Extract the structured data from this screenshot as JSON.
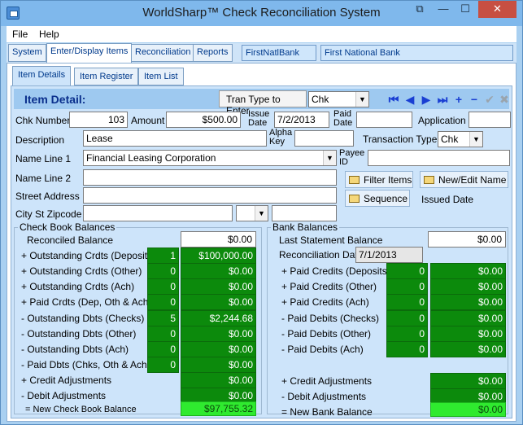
{
  "window": {
    "title": "WorldSharp™ Check Reconciliation System"
  },
  "menu": {
    "file": "File",
    "help": "Help"
  },
  "main_tabs": {
    "system": "System",
    "enter_display": "Enter/Display Items",
    "reconciliation": "Reconciliation",
    "reports": "Reports",
    "bank_code": "FirstNatlBank",
    "bank_name": "First National Bank"
  },
  "sub_tabs": {
    "item_details": "Item Details",
    "item_register": "Item Register",
    "item_list": "Item List"
  },
  "item_detail": {
    "title": "Item Detail:",
    "tran_type_label": "Tran Type to Enter",
    "tran_type_value": "Chk"
  },
  "form": {
    "chk_number_label": "Chk Number",
    "chk_number": "103",
    "amount_label": "Amount",
    "amount": "$500.00",
    "issue_date_label": "Issue Date",
    "issue_date": "7/2/2013",
    "paid_date_label": "Paid Date",
    "paid_date": "",
    "application_label": "Application",
    "application": "",
    "description_label": "Description",
    "description": "Lease",
    "alpha_key_label": "Alpha Key",
    "alpha_key": "",
    "transaction_type_label": "Transaction Type",
    "transaction_type": "Chk",
    "name_line1_label": "Name Line 1",
    "name_line1": "Financial Leasing Corporation",
    "payee_id_label": "Payee ID",
    "payee_id": "",
    "name_line2_label": "Name Line 2",
    "street_address_label": "Street Address",
    "city_st_zip_label": "City St Zipcode",
    "filter_items": "Filter Items",
    "new_edit_name": "New/Edit Name",
    "sequence": "Sequence",
    "issued_date_label": "Issued Date"
  },
  "checkbook": {
    "title": "Check Book Balances",
    "reconciled_balance_label": "Reconciled Balance",
    "reconciled_balance": "$0.00",
    "rows": [
      {
        "label": "+ Outstanding Crdts (Deposits)",
        "count": "1",
        "amount": "$100,000.00"
      },
      {
        "label": "+ Outstanding Crdts (Other)",
        "count": "0",
        "amount": "$0.00"
      },
      {
        "label": "+ Outstanding Crdts (Ach)",
        "count": "0",
        "amount": "$0.00"
      },
      {
        "label": "+ Paid Crdts (Dep, Oth & Ach)",
        "count": "0",
        "amount": "$0.00"
      },
      {
        "label": "- Outstanding Dbts (Checks)",
        "count": "5",
        "amount": "$2,244.68"
      },
      {
        "label": "- Outstanding Dbts (Other)",
        "count": "0",
        "amount": "$0.00"
      },
      {
        "label": "- Outstanding Dbts (Ach)",
        "count": "0",
        "amount": "$0.00"
      },
      {
        "label": "- Paid Dbts (Chks, Oth & Ach)",
        "count": "0",
        "amount": "$0.00"
      }
    ],
    "credit_adj_label": "+ Credit Adjustments",
    "credit_adj": "$0.00",
    "debit_adj_label": "- Debit Adjustments",
    "debit_adj": "$0.00",
    "new_balance_label": "= New Check Book Balance",
    "new_balance": "$97,755.32"
  },
  "bank": {
    "title": "Bank Balances",
    "last_statement_label": "Last Statement Balance",
    "last_statement": "$0.00",
    "recon_date_label": "Reconciliation Date",
    "recon_date": "7/1/2013",
    "rows": [
      {
        "label": "+ Paid Credits (Deposits)",
        "count": "0",
        "amount": "$0.00"
      },
      {
        "label": "+ Paid Credits (Other)",
        "count": "0",
        "amount": "$0.00"
      },
      {
        "label": "+ Paid Credits (Ach)",
        "count": "0",
        "amount": "$0.00"
      },
      {
        "label": "- Paid Debits (Checks)",
        "count": "0",
        "amount": "$0.00"
      },
      {
        "label": "- Paid Debits (Other)",
        "count": "0",
        "amount": "$0.00"
      },
      {
        "label": "- Paid Debits (Ach)",
        "count": "0",
        "amount": "$0.00"
      }
    ],
    "credit_adj_label": "+ Credit Adjustments",
    "credit_adj": "$0.00",
    "debit_adj_label": "- Debit Adjustments",
    "debit_adj": "$0.00",
    "new_balance_label": "= New Bank Balance",
    "new_balance": "$0.00"
  }
}
